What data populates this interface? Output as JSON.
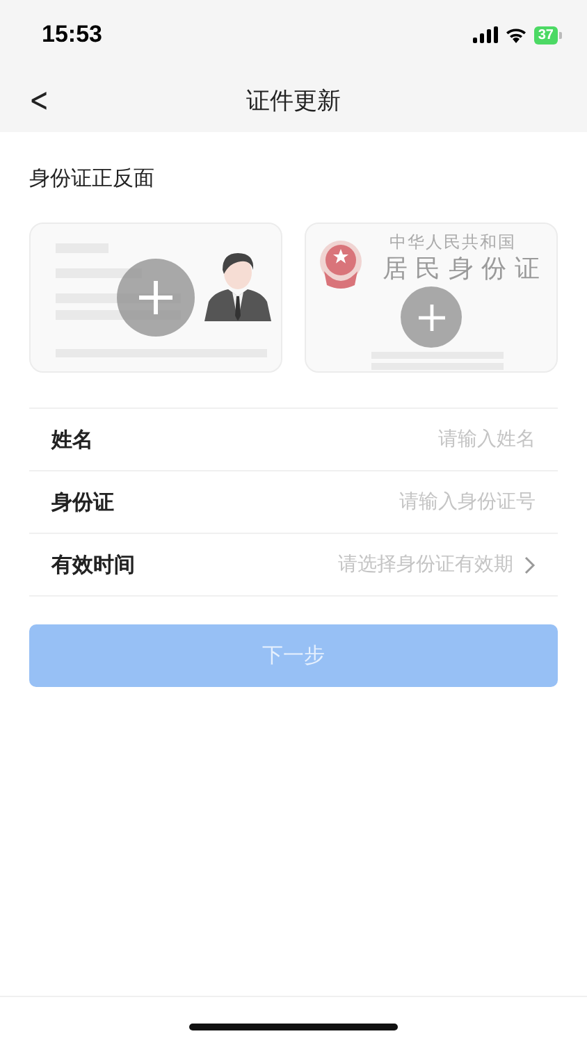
{
  "status_bar": {
    "time": "15:53",
    "battery": "37"
  },
  "nav": {
    "back": "<",
    "title": "证件更新"
  },
  "section_title": "身份证正反面",
  "cards": [
    {
      "kind": "front"
    },
    {
      "kind": "back",
      "country": "中华人民共和国",
      "doc_name": "居 民 身 份 证"
    }
  ],
  "fields": [
    {
      "kind": "input",
      "label": "姓名",
      "placeholder": "请输入姓名"
    },
    {
      "kind": "input",
      "label": "身份证",
      "placeholder": "请输入身份证号"
    },
    {
      "kind": "select",
      "label": "有效时间",
      "placeholder": "请选择身份证有效期"
    }
  ],
  "button": {
    "label": "下一步",
    "disabled": true
  }
}
